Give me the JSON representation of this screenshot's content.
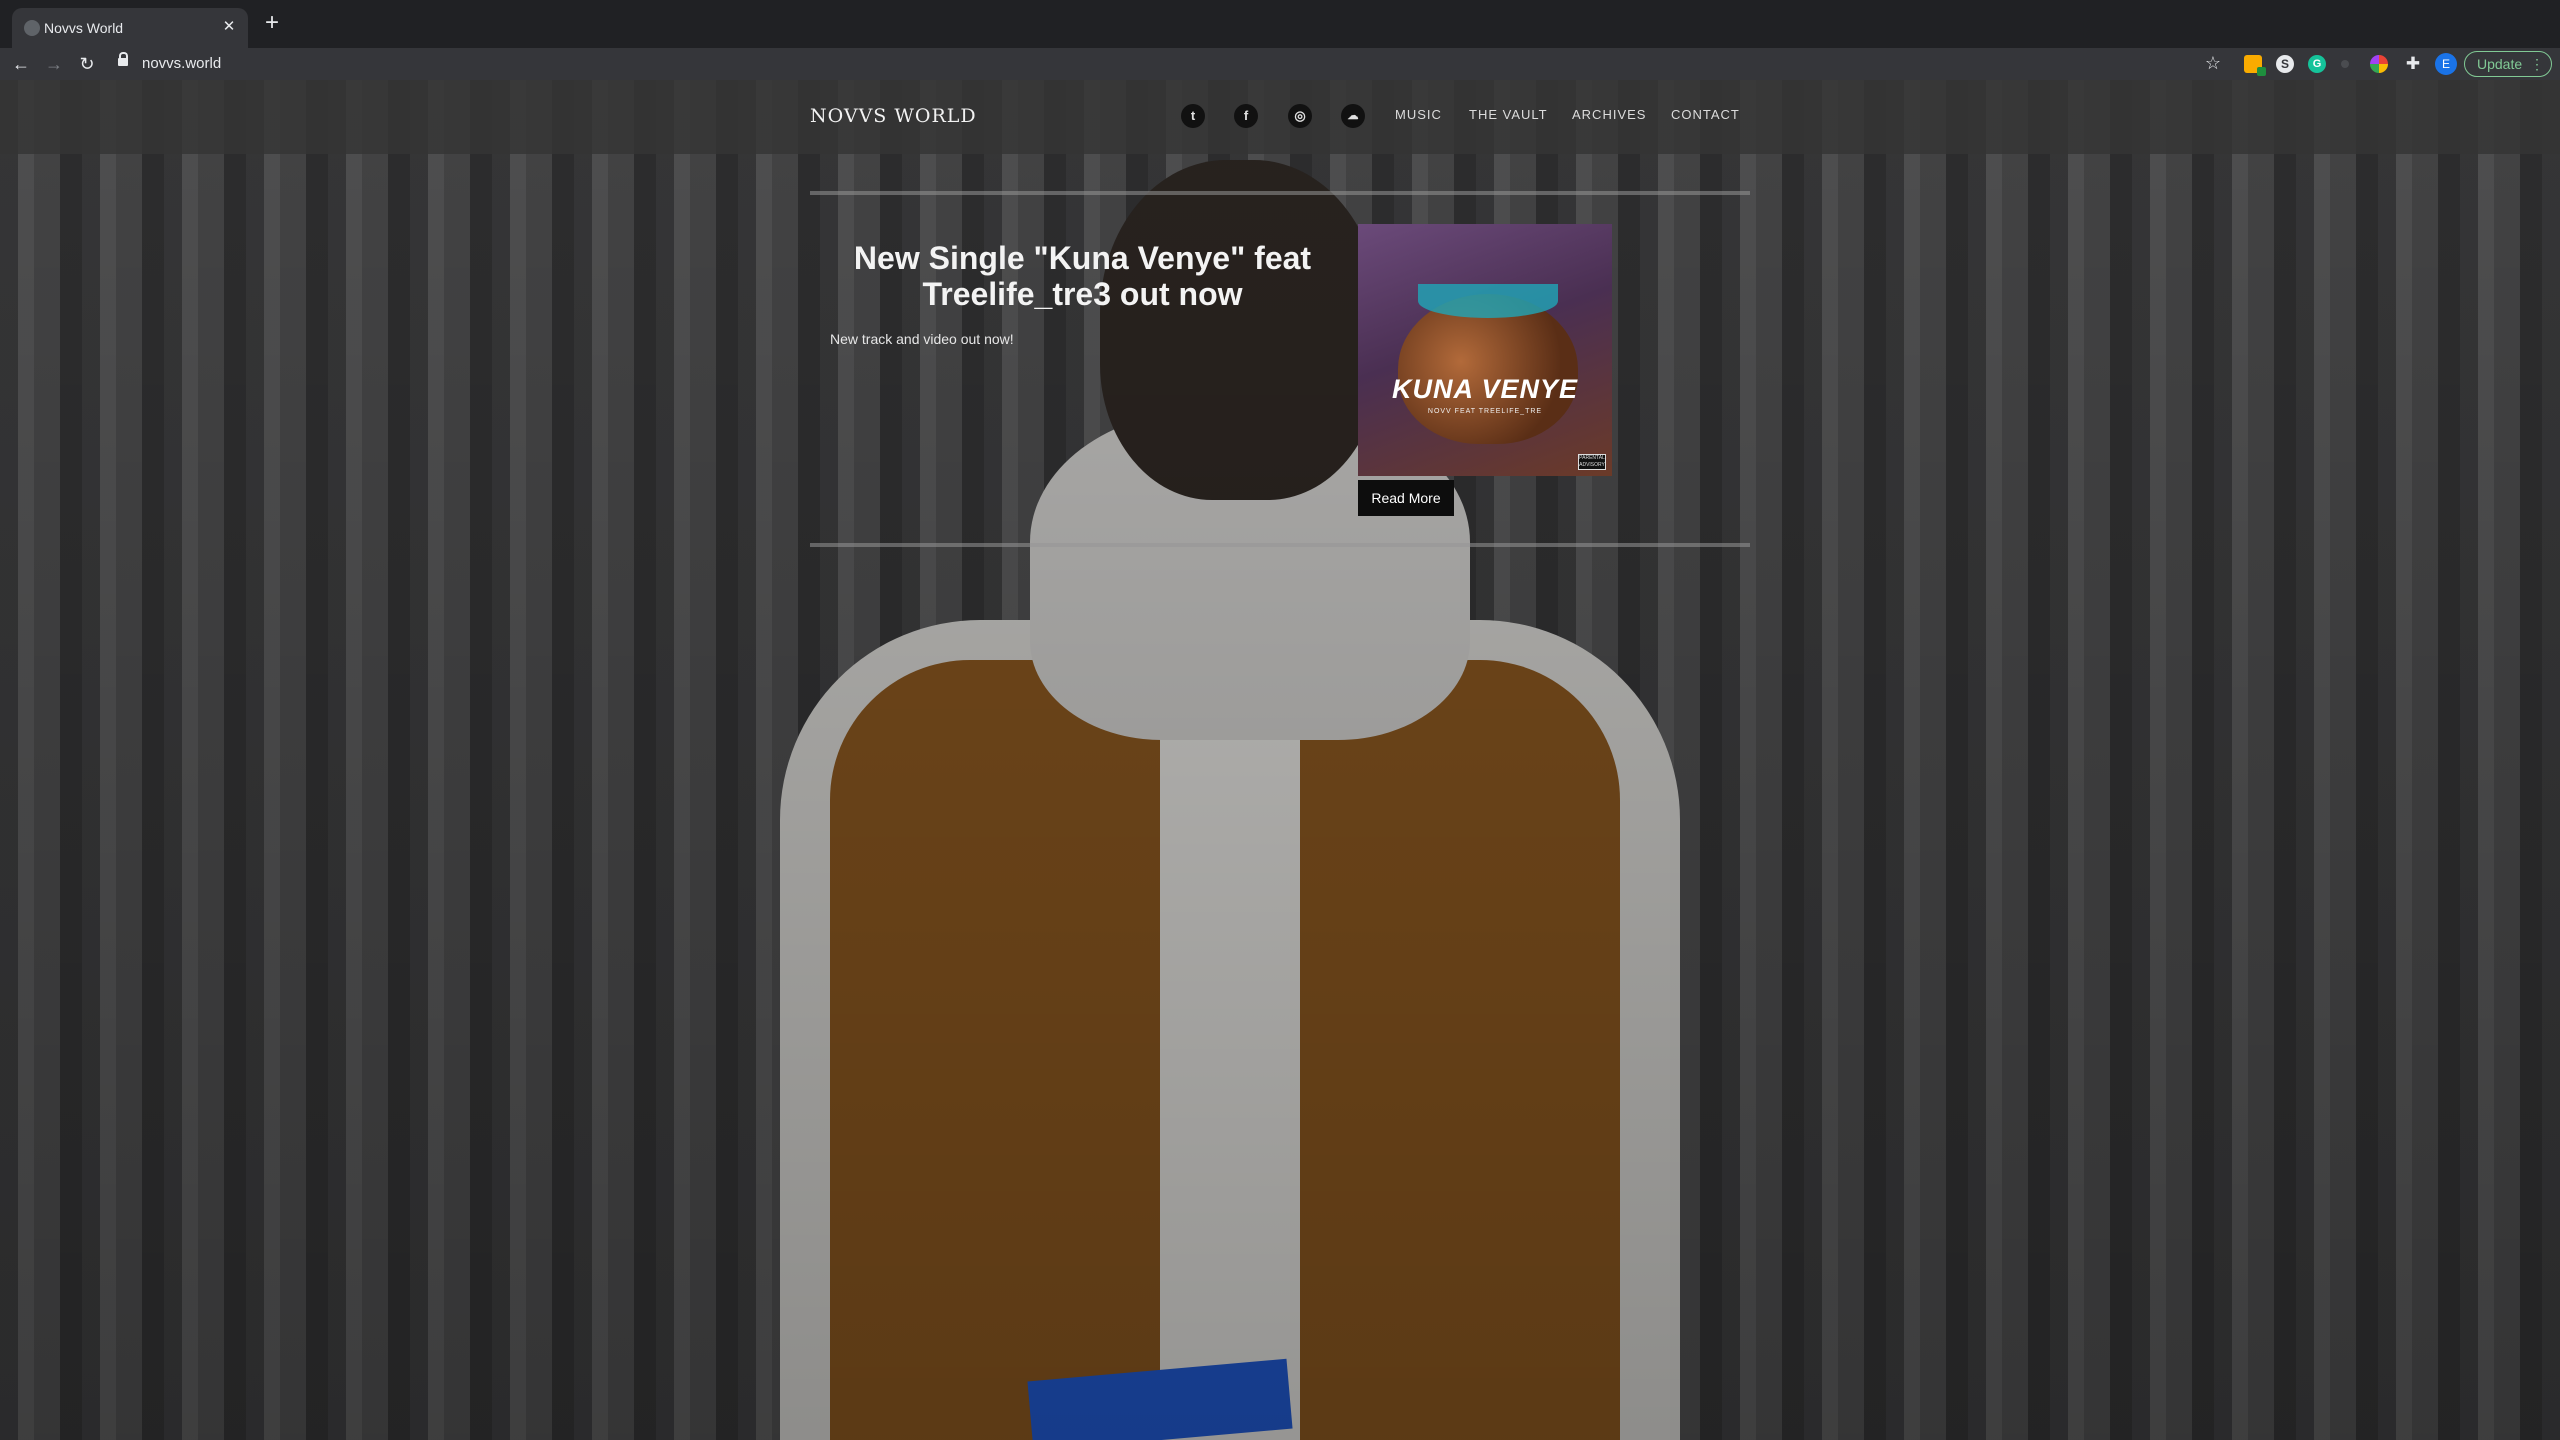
{
  "browser": {
    "tab_title": "Novvs World",
    "url": "novvs.world",
    "update_label": "Update",
    "profile_initial": "E",
    "ext_s_label": "S",
    "ext_g_label": "G"
  },
  "site": {
    "title": "NOVVS WORLD",
    "social": [
      {
        "name": "twitter",
        "glyph": "t"
      },
      {
        "name": "facebook",
        "glyph": "f"
      },
      {
        "name": "instagram",
        "glyph": "◎"
      },
      {
        "name": "soundcloud",
        "glyph": "☁"
      }
    ],
    "nav": [
      "MUSIC",
      "THE VAULT",
      "ARCHIVES",
      "CONTACT"
    ]
  },
  "post": {
    "title": "New Single \"Kuna Venye\" feat Treelife_tre3 out now",
    "excerpt": "New track and video out now!",
    "read_more": "Read More",
    "cover": {
      "title": "KUNA VENYE",
      "subtitle": "NOVV FEAT TREELIFE_TRE",
      "advisory": "PARENTAL ADVISORY"
    }
  },
  "colors": {
    "header_bg": "#343435",
    "accent_update": "#81c995",
    "button_bg": "#0d0d0d"
  }
}
